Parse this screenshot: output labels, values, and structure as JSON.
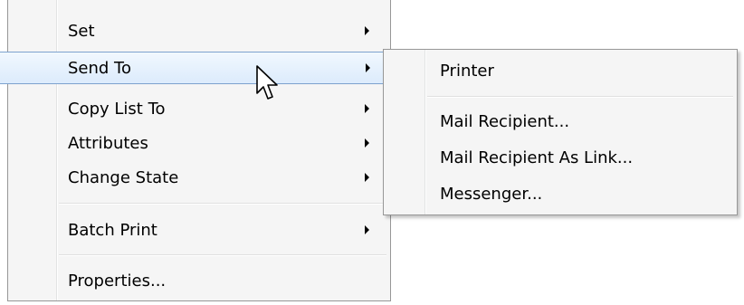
{
  "context_menu": {
    "items": [
      {
        "label": "Set",
        "has_submenu": true
      },
      {
        "label": "Send To",
        "has_submenu": true,
        "highlighted": true
      },
      {
        "label": "Copy List To",
        "has_submenu": true
      },
      {
        "label": "Attributes",
        "has_submenu": true
      },
      {
        "label": "Change State",
        "has_submenu": true
      },
      {
        "label": "Batch Print",
        "has_submenu": true
      },
      {
        "label": "Properties...",
        "has_submenu": false
      }
    ]
  },
  "send_to_submenu": {
    "items": [
      {
        "label": "Printer"
      },
      {
        "label": "Mail Recipient..."
      },
      {
        "label": "Mail Recipient As Link..."
      },
      {
        "label": "Messenger..."
      }
    ]
  },
  "icons": {
    "submenu_arrow": "chevron-right-icon",
    "cursor": "mouse-pointer-icon"
  },
  "colors": {
    "menu_background": "#f5f5f5",
    "menu_border": "#979797",
    "highlight_border": "#7da2ce",
    "highlight_fill": "#dcebfc"
  }
}
